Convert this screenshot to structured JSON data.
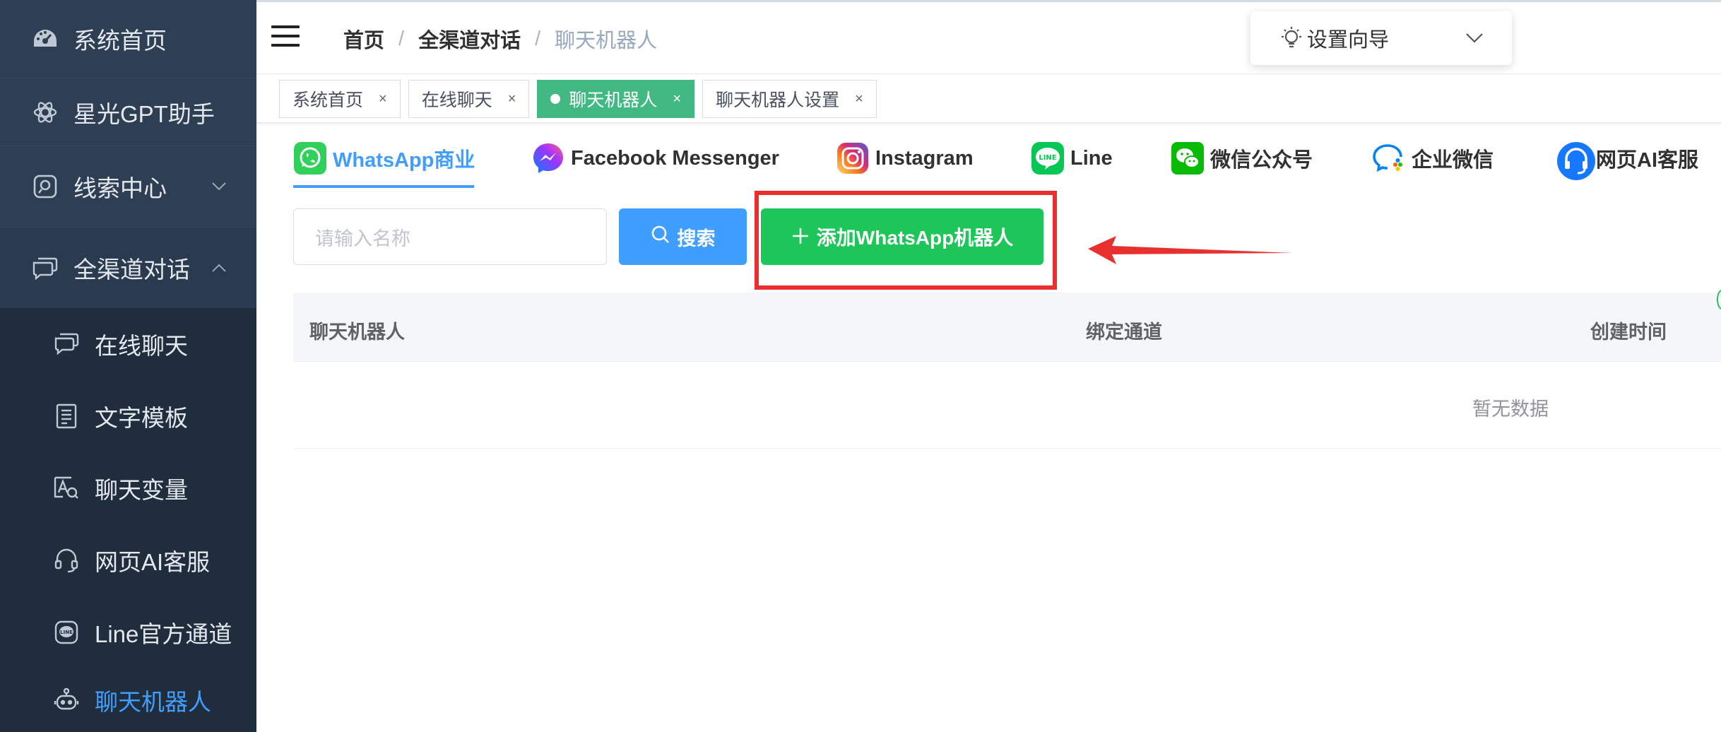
{
  "sidebar": {
    "items": [
      {
        "label": "系统首页",
        "icon": "dashboard-icon"
      },
      {
        "label": "星光GPT助手",
        "icon": "openai-icon"
      },
      {
        "label": "线索中心",
        "icon": "search-square-icon",
        "expanded": false
      },
      {
        "label": "全渠道对话",
        "icon": "chat-bubbles-icon",
        "expanded": true
      },
      {
        "label": "在线聊天",
        "icon": "chat-icon"
      },
      {
        "label": "文字模板",
        "icon": "document-icon"
      },
      {
        "label": "聊天变量",
        "icon": "variable-icon"
      },
      {
        "label": "网页AI客服",
        "icon": "headset-icon"
      },
      {
        "label": "Line官方通道",
        "icon": "line-icon"
      },
      {
        "label": "聊天机器人",
        "icon": "robot-icon",
        "active": true
      }
    ],
    "colors": {
      "background": "#263445",
      "active": "#409eff"
    }
  },
  "header": {
    "breadcrumb": [
      "首页",
      "全渠道对话",
      "聊天机器人"
    ],
    "separator": "/",
    "guide_label": "设置向导"
  },
  "tags": [
    {
      "label": "系统首页",
      "active": false
    },
    {
      "label": "在线聊天",
      "active": false
    },
    {
      "label": "聊天机器人",
      "active": true
    },
    {
      "label": "聊天机器人设置",
      "active": false
    }
  ],
  "tag_close": "×",
  "channels": [
    {
      "label": "WhatsApp商业",
      "icon": "whatsapp-icon",
      "active": true
    },
    {
      "label": "Facebook Messenger",
      "icon": "messenger-icon"
    },
    {
      "label": "Instagram",
      "icon": "instagram-icon"
    },
    {
      "label": "Line",
      "icon": "line-icon"
    },
    {
      "label": "微信公众号",
      "icon": "wechat-icon"
    },
    {
      "label": "企业微信",
      "icon": "wecom-icon"
    },
    {
      "label": "网页AI客服",
      "icon": "web-ai-service-icon"
    }
  ],
  "search": {
    "placeholder": "请输入名称",
    "button_label": "搜索",
    "add_button_label": "添加WhatsApp机器人"
  },
  "table": {
    "columns": [
      "聊天机器人",
      "绑定通道",
      "创建时间"
    ],
    "empty_text": "暂无数据"
  },
  "colors": {
    "primary": "#409eff",
    "success": "#1ec65a",
    "highlight": "#e8312f",
    "tag_active": "#42b983"
  }
}
